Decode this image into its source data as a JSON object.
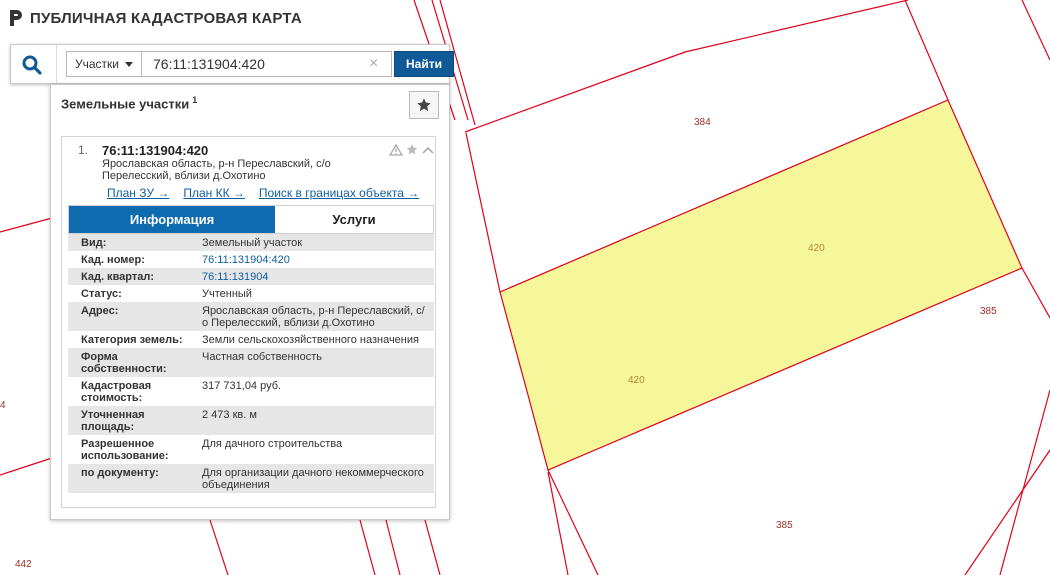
{
  "app": {
    "title": "ПУБЛИЧНАЯ КАДАСТРОВАЯ КАРТА"
  },
  "search": {
    "type_label": "Участки",
    "query": "76:11:131904:420",
    "clear_symbol": "×",
    "find_label": "Найти"
  },
  "panel": {
    "title": "Земельные участки",
    "count": "1"
  },
  "result": {
    "number": "1.",
    "cad_number": "76:11:131904:420",
    "address_line1": "Ярославская область, р-н Переславский, с/о",
    "address_line2": "Перелесский, вблизи д.Охотино",
    "links": [
      "План ЗУ →",
      "План КК →",
      "Поиск в границах объекта →"
    ]
  },
  "tabs": {
    "info": "Информация",
    "services": "Услуги"
  },
  "info_rows": [
    {
      "label": "Вид:",
      "value": "Земельный участок",
      "link": false
    },
    {
      "label": "Кад. номер:",
      "value": "76:11:131904:420",
      "link": true
    },
    {
      "label": "Кад. квартал:",
      "value": "76:11:131904",
      "link": true
    },
    {
      "label": "Статус:",
      "value": "Учтенный",
      "link": false
    },
    {
      "label": "Адрес:",
      "value": "Ярославская область, р-н Переславский, с/о Перелесский, вблизи д.Охотино",
      "link": false
    },
    {
      "label": "Категория земель:",
      "value": "Земли сельскохозяйственного назначения",
      "link": false
    },
    {
      "label": "Форма собственности:",
      "value": "Частная собственность",
      "link": false
    },
    {
      "label": "Кадастровая стоимость:",
      "value": "317 731,04 руб.",
      "link": false
    },
    {
      "label": "Уточненная площадь:",
      "value": "2 473 кв. м",
      "link": false
    },
    {
      "label": "Разрешенное использование:",
      "value": "Для дачного строительства",
      "link": false
    },
    {
      "label": "по документу:",
      "value": "Для организации дачного некоммерческого объединения",
      "link": false
    }
  ],
  "map_labels": {
    "l384": "384",
    "l420a": "420",
    "l420b": "420",
    "l385a": "385",
    "l385b": "385",
    "l4": "4",
    "l442": "442"
  },
  "colors": {
    "parcel_line": "#e2001a",
    "selected_fill": "#f6f79a",
    "accent": "#0f6bb0",
    "button": "#0f5a96",
    "link": "#1060a0",
    "map_label": "#a0302a"
  },
  "icons": {
    "logo": "pkk-logo-icon",
    "search": "search-icon",
    "favorite": "star-icon",
    "warning": "warning-icon",
    "collapse": "chevron-up-icon"
  }
}
